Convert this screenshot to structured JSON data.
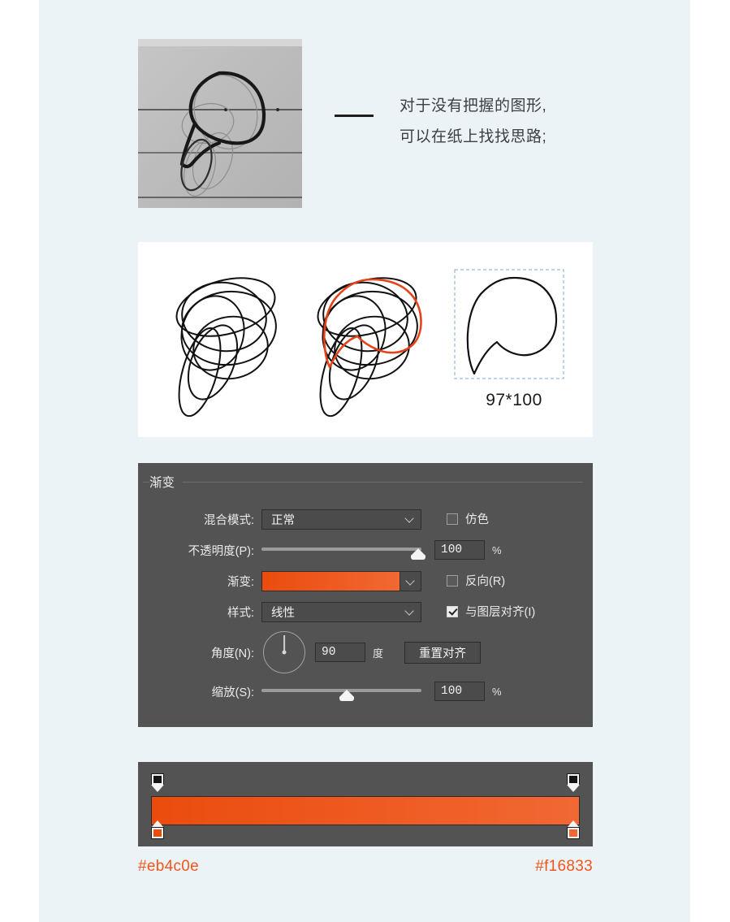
{
  "theme": {
    "page_background": "#ffffff",
    "band_background": "#ecf3f6",
    "panel_background": "#535353",
    "accent_orange": "#f2551b",
    "gradient_start": "#eb4c0e",
    "gradient_end": "#f16833"
  },
  "caption": {
    "line1": "对于没有把握的图形,",
    "line2": "可以在纸上找找思路;"
  },
  "sketch": {
    "dimensions_label": "97*100"
  },
  "panel": {
    "group_title": "渐变",
    "blend_mode": {
      "label": "混合模式:",
      "value": "正常"
    },
    "dither": {
      "label": "仿色",
      "checked": false
    },
    "opacity": {
      "label": "不透明度(P):",
      "value": "100",
      "unit": "%",
      "slider_percent": 100
    },
    "gradient": {
      "label": "渐变:",
      "swatch_start": "#eb4c0e",
      "swatch_end": "#f16833"
    },
    "reverse": {
      "label": "反向(R)",
      "checked": false
    },
    "style": {
      "label": "样式:",
      "value": "线性"
    },
    "align_with_layer": {
      "label": "与图层对齐(I)",
      "checked": true
    },
    "angle": {
      "label": "角度(N):",
      "value": "90",
      "unit": "度",
      "degrees": 90
    },
    "reset_align_button": "重置对齐",
    "scale": {
      "label": "缩放(S):",
      "value": "100",
      "unit": "%",
      "slider_percent": 53
    }
  },
  "gradient_bar": {
    "opacity_stops": [
      {
        "position_percent": 0,
        "color": "#151515"
      },
      {
        "position_percent": 100,
        "color": "#151515"
      }
    ],
    "color_stops": [
      {
        "position_percent": 0,
        "color": "#eb4c0e"
      },
      {
        "position_percent": 100,
        "color": "#f16833"
      }
    ]
  },
  "hex_labels": {
    "left": "#eb4c0e",
    "right": "#f16833"
  }
}
